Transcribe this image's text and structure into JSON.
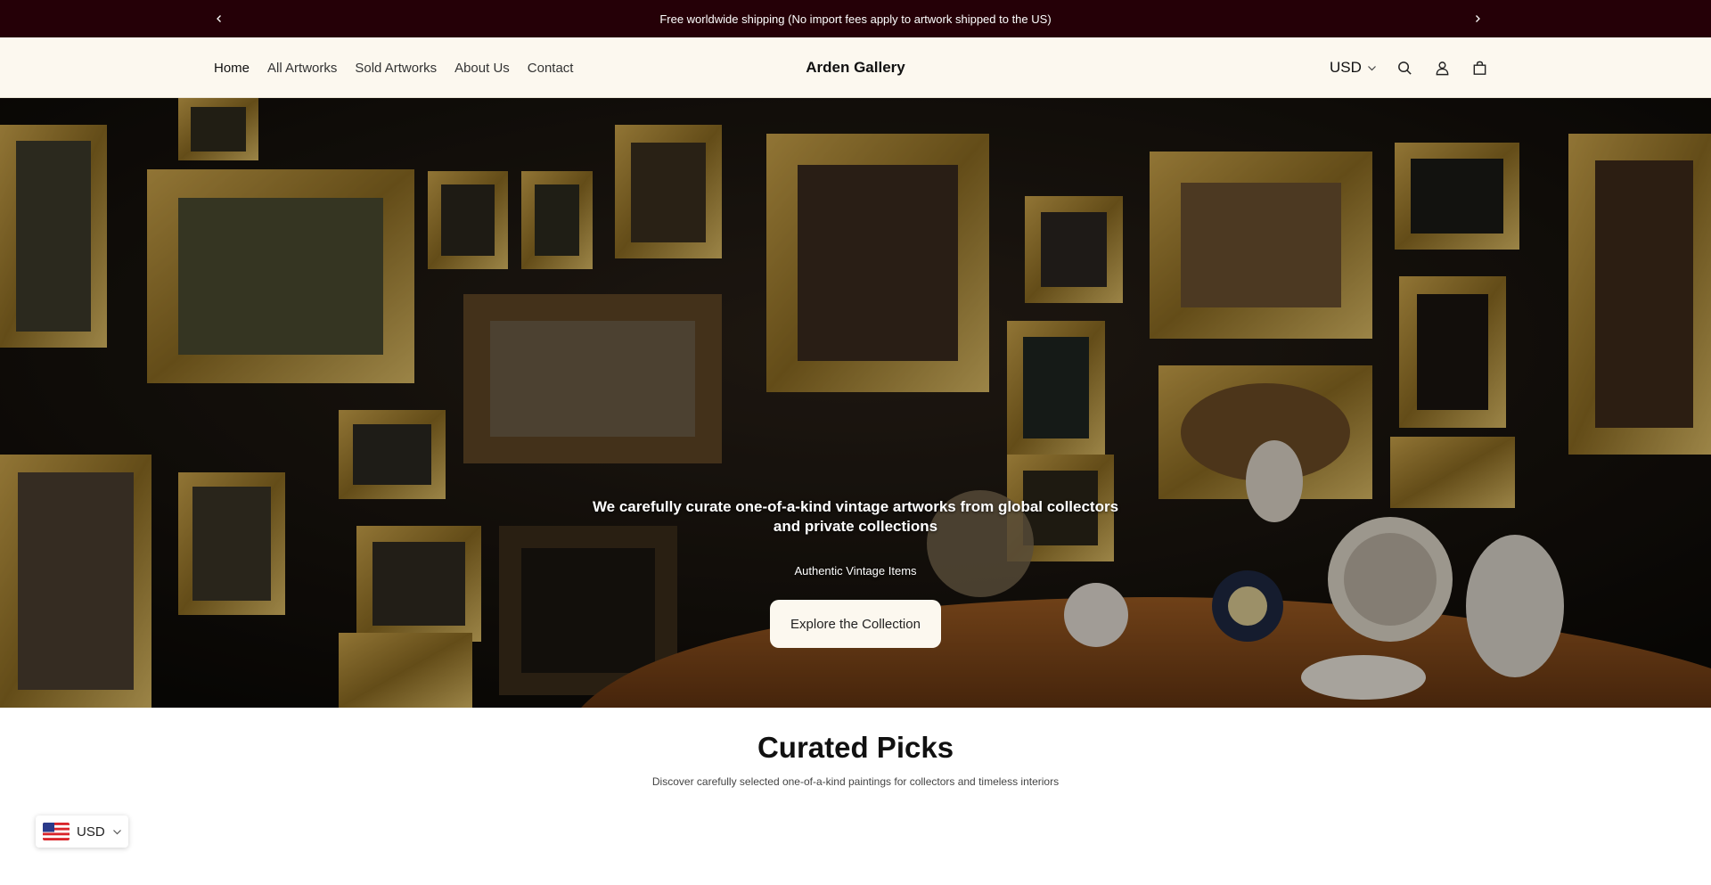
{
  "announcement": {
    "text": "Free worldwide shipping (No import fees apply to artwork shipped to the US)",
    "prev_icon": "chevron-left-icon",
    "next_icon": "chevron-right-icon"
  },
  "header": {
    "nav": [
      {
        "label": "Home",
        "active": true
      },
      {
        "label": "All Artworks"
      },
      {
        "label": "Sold Artworks"
      },
      {
        "label": "About Us"
      },
      {
        "label": "Contact"
      }
    ],
    "brand": "Arden Gallery",
    "currency": "USD",
    "icons": [
      "search-icon",
      "account-icon",
      "cart-icon"
    ]
  },
  "hero": {
    "heading": "We carefully curate one-of-a-kind vintage artworks from global collectors and private collections",
    "subheading": "Authentic Vintage Items",
    "button": "Explore the Collection"
  },
  "curated": {
    "title": "Curated Picks",
    "subtitle": "Discover carefully selected one-of-a-kind paintings for collectors and timeless interiors"
  },
  "currency_widget": {
    "code": "USD",
    "flag": "us-flag-icon"
  },
  "colors": {
    "announcement_bg": "#250007",
    "header_bg": "#fcf8ef",
    "button_bg": "#fcf8ef"
  }
}
